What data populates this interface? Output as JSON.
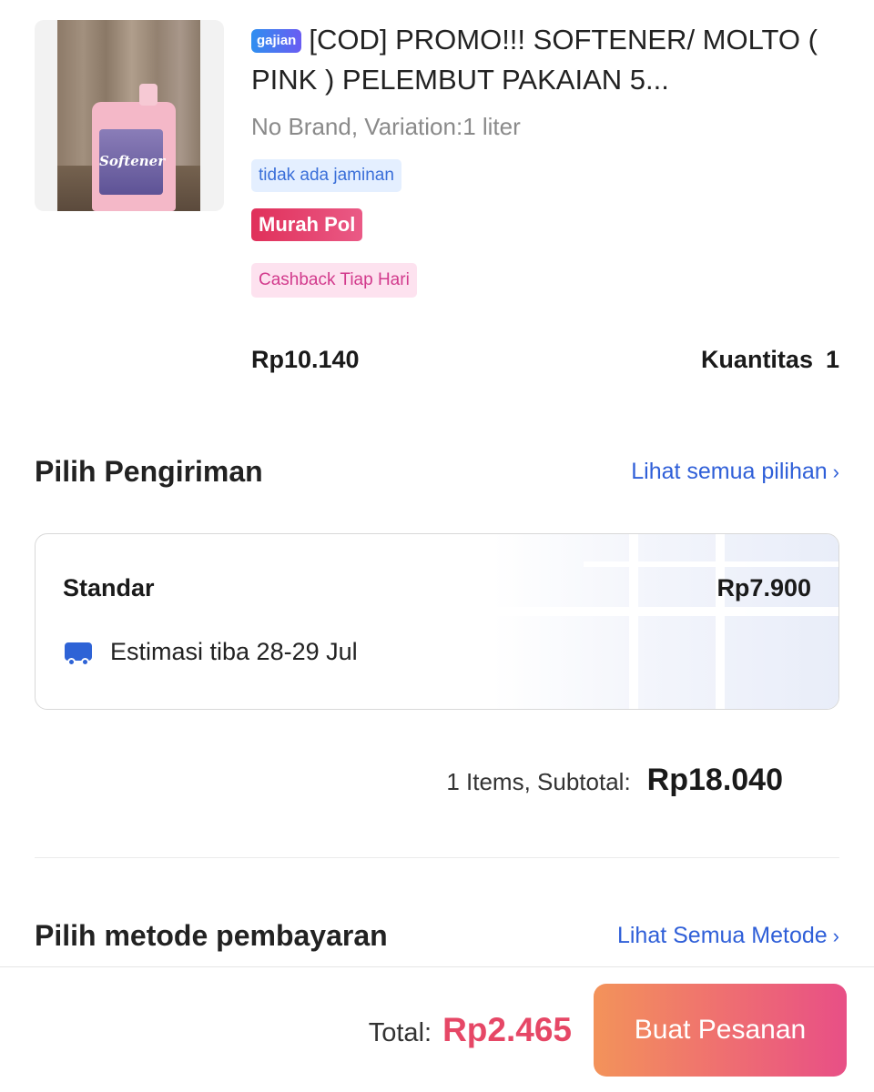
{
  "product": {
    "image_label": "Softener",
    "badge": "gajian",
    "title": "[COD] PROMO!!! SOFTENER/ MOLTO ( PINK ) PELEMBUT PAKAIAN 5...",
    "variant": "No Brand, Variation:1 liter",
    "tags": {
      "warranty": "tidak ada jaminan",
      "promo": "Murah Pol",
      "cashback": "Cashback Tiap Hari"
    },
    "price": "Rp10.140",
    "quantity_label": "Kuantitas",
    "quantity_value": "1"
  },
  "shipping": {
    "title": "Pilih Pengiriman",
    "see_all": "Lihat semua pilihan",
    "option_name": "Standar",
    "option_price": "Rp7.900",
    "estimate": "Estimasi tiba 28-29 Jul"
  },
  "subtotal": {
    "label": "1 Items, Subtotal:",
    "value": "Rp18.040"
  },
  "payment": {
    "title": "Pilih metode pembayaran",
    "see_all": "Lihat Semua Metode"
  },
  "footer": {
    "total_label": "Total:",
    "total_value": "Rp2.465",
    "order_button": "Buat Pesanan"
  },
  "icons": {
    "chevron": "chevron-right-icon",
    "truck": "delivery-truck-icon"
  },
  "colors": {
    "accent_blue": "#2f5fd8",
    "total_red": "#e64766",
    "button_gradient_start": "#f3935a",
    "button_gradient_end": "#e84f86"
  }
}
